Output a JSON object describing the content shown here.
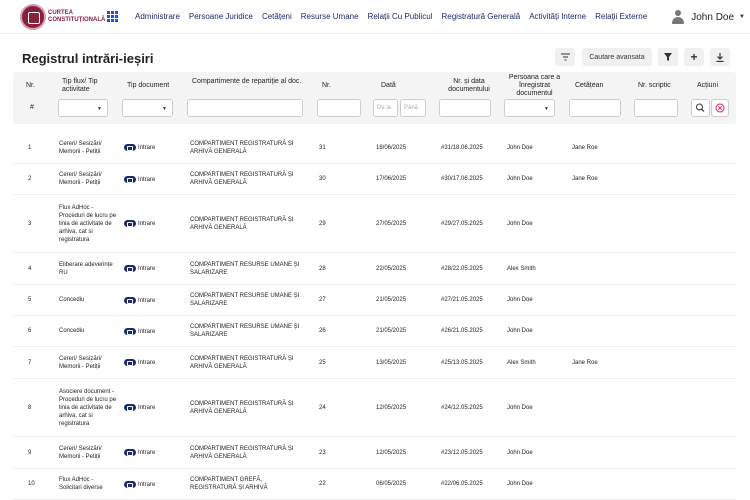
{
  "brand": {
    "logo_text": "CURTEA CONSTITUȚIONALĂ"
  },
  "nav": {
    "items": [
      "Administrare",
      "Persoane Juridice",
      "Cetățeni",
      "Resurse Umane",
      "Relații Cu Publicul",
      "Registratură Generală",
      "Activități Interne",
      "Relații Externe"
    ]
  },
  "user": {
    "name": "John Doe"
  },
  "page": {
    "title": "Registrul intrări-ieșiri"
  },
  "toolbar": {
    "advanced_search": "Cautare avansata",
    "add": "+"
  },
  "columns": {
    "nr": "Nr.",
    "tip_flux": "Tip flux/ Tip activitate",
    "tip_document": "Tip document",
    "compartimente": "Compartimente de repartiție al doc.",
    "nr2": "Nr.",
    "data": "Dată",
    "nr_data_doc": "Nr. și data documentului",
    "persoana": "Persoana care a înregistrat documentul",
    "cetatean": "Cetățean",
    "nr_scriptic": "Nr. scriptic",
    "actiuni": "Acțiuni"
  },
  "filters": {
    "hash": "#",
    "date_from": "De la",
    "date_to": "Până"
  },
  "rows": [
    {
      "nr": "1",
      "tip": "Cereri/ Sesizări/ Memorii - Petiții",
      "doc": "Intrare",
      "comp": "COMPARTIMENT REGISTRATURĂ ȘI ARHIVĂ GENERALĂ",
      "n": "31",
      "data": "18/06/2025",
      "nrdoc": "#31/18.06.2025",
      "pers": "John Doe",
      "cet": "Jane Roe"
    },
    {
      "nr": "2",
      "tip": "Cereri/ Sesizări/ Memorii - Petiții",
      "doc": "Intrare",
      "comp": "COMPARTIMENT REGISTRATURĂ ȘI ARHIVĂ GENERALĂ",
      "n": "30",
      "data": "17/06/2025",
      "nrdoc": "#30/17.06.2025",
      "pers": "John Doe",
      "cet": "Jane Roe"
    },
    {
      "nr": "3",
      "tip": "Flux AdHoc - Proceduri de lucru pe linia de activitate de arhiva, cat si registratura",
      "doc": "Intrare",
      "comp": "COMPARTIMENT REGISTRATURĂ ȘI ARHIVĂ GENERALĂ",
      "n": "29",
      "data": "27/05/2025",
      "nrdoc": "#29/27.05.2025",
      "pers": "John Doe",
      "cet": ""
    },
    {
      "nr": "4",
      "tip": "Eliberare adeverințe RU",
      "doc": "Intrare",
      "comp": "COMPARTIMENT RESURSE UMANE ȘI SALARIZARE",
      "n": "28",
      "data": "22/05/2025",
      "nrdoc": "#28/22.05.2025",
      "pers": "Alex Smith",
      "cet": ""
    },
    {
      "nr": "5",
      "tip": "Concediu",
      "doc": "Intrare",
      "comp": "COMPARTIMENT RESURSE UMANE ȘI SALARIZARE",
      "n": "27",
      "data": "21/05/2025",
      "nrdoc": "#27/21.05.2025",
      "pers": "John Doe",
      "cet": ""
    },
    {
      "nr": "6",
      "tip": "Concediu",
      "doc": "Intrare",
      "comp": "COMPARTIMENT RESURSE UMANE ȘI SALARIZARE",
      "n": "26",
      "data": "21/05/2025",
      "nrdoc": "#26/21.05.2025",
      "pers": "John Doe",
      "cet": ""
    },
    {
      "nr": "7",
      "tip": "Cereri/ Sesizări/ Memorii - Petiții",
      "doc": "Intrare",
      "comp": "COMPARTIMENT REGISTRATURĂ ȘI ARHIVĂ GENERALĂ",
      "n": "25",
      "data": "13/05/2025",
      "nrdoc": "#25/13.05.2025",
      "pers": "Alex Smith",
      "cet": "Jane Roe"
    },
    {
      "nr": "8",
      "tip": "Asociere document - Proceduri de lucru pe linia de activitate de arhiva, cat si registratura",
      "doc": "Intrare",
      "comp": "COMPARTIMENT REGISTRATURĂ ȘI ARHIVĂ GENERALĂ",
      "n": "24",
      "data": "12/05/2025",
      "nrdoc": "#24/12.05.2025",
      "pers": "John Doe",
      "cet": ""
    },
    {
      "nr": "9",
      "tip": "Cereri/ Sesizări/ Memorii - Petiții",
      "doc": "Intrare",
      "comp": "COMPARTIMENT REGISTRATURĂ ȘI ARHIVĂ GENERALĂ",
      "n": "23",
      "data": "12/05/2025",
      "nrdoc": "#23/12.05.2025",
      "pers": "John Doe",
      "cet": ""
    },
    {
      "nr": "10",
      "tip": "Flux AdHoc - Solicitari diverse",
      "doc": "Intrare",
      "comp": "COMPARTIMENT GREFĂ, REGISTRATURĂ ȘI ARHIVĂ",
      "n": "22",
      "data": "06/05/2025",
      "nrdoc": "#22/06.05.2025",
      "pers": "John Doe",
      "cet": ""
    }
  ]
}
